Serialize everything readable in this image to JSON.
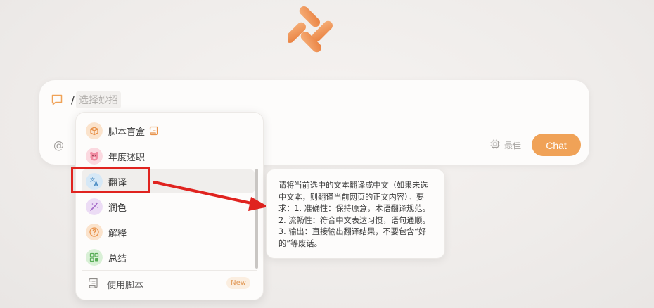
{
  "input": {
    "slash": "/",
    "command_placeholder": "选择妙招"
  },
  "toolbar": {
    "at_symbol": "@",
    "model_label": "最佳",
    "chat_label": "Chat"
  },
  "menu": {
    "items": [
      {
        "label": "脚本盲盒",
        "icon": "box-icon",
        "color": "#f0a257"
      },
      {
        "label": "年度述职",
        "icon": "pig-icon",
        "color": "#ec6f8a"
      },
      {
        "label": "翻译",
        "icon": "translate-icon",
        "color": "#6ea9d6"
      },
      {
        "label": "润色",
        "icon": "magic-wand-icon",
        "color": "#b27fd1"
      },
      {
        "label": "解释",
        "icon": "question-icon",
        "color": "#f0a257"
      },
      {
        "label": "总结",
        "icon": "grid-icon",
        "color": "#6cbf6a"
      }
    ],
    "use_script_label": "使用脚本",
    "new_badge": "New"
  },
  "tooltip": {
    "text": "请将当前选中的文本翻译成中文（如果未选中文本，则翻译当前网页的正文内容）。要求：1. 准确性：保持原意，术语翻译规范。2. 流畅性：符合中文表达习惯，语句通顺。3. 输出：直接输出翻译结果，不要包含“好的”等废话。"
  },
  "colors": {
    "accent": "#f0a257",
    "annotation": "#e0231f"
  }
}
